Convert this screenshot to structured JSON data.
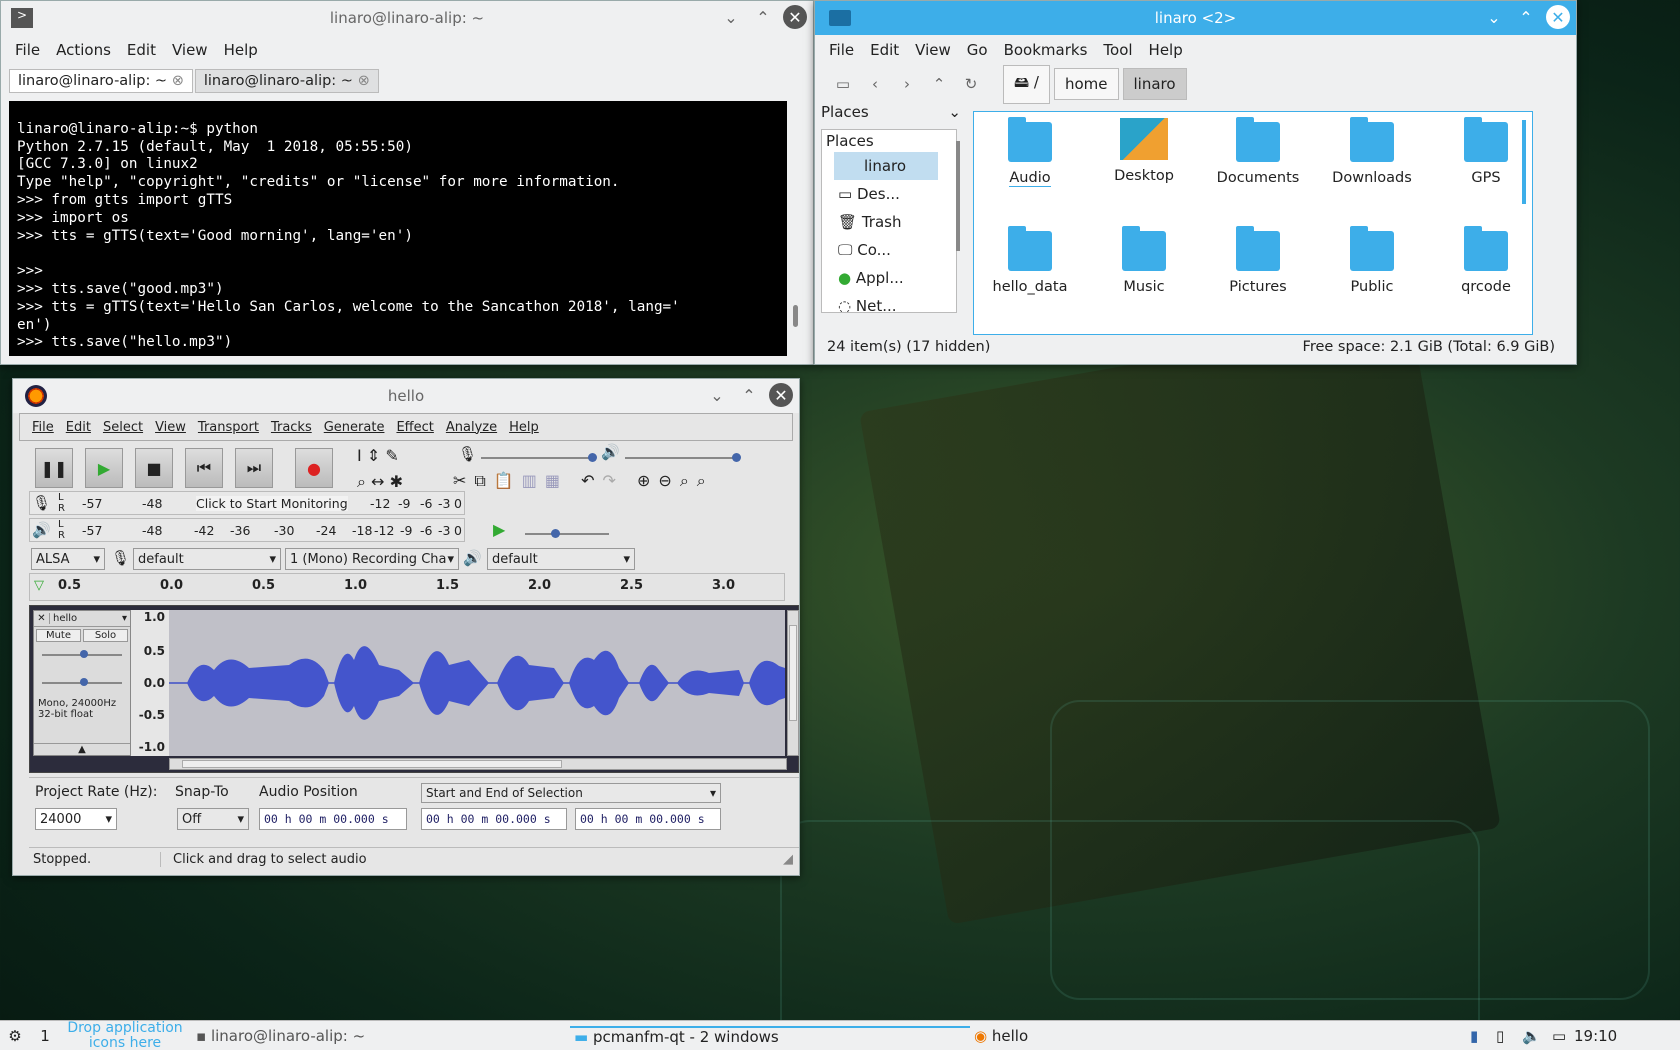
{
  "terminal": {
    "title": "linaro@linaro-alip: ~",
    "menu": [
      "File",
      "Actions",
      "Edit",
      "View",
      "Help"
    ],
    "tabs": [
      "linaro@linaro-alip: ~",
      "linaro@linaro-alip: ~"
    ],
    "lines": [
      "linaro@linaro-alip:~$ python",
      "Python 2.7.15 (default, May  1 2018, 05:55:50)",
      "[GCC 7.3.0] on linux2",
      "Type \"help\", \"copyright\", \"credits\" or \"license\" for more information.",
      ">>> from gtts import gTTS",
      ">>> import os",
      ">>> tts = gTTS(text='Good morning', lang='en')",
      "",
      ">>> ",
      ">>> tts.save(\"good.mp3\")",
      ">>> tts = gTTS(text='Hello San Carlos, welcome to the Sancathon 2018', lang='",
      "en')",
      ">>> tts.save(\"hello.mp3\")"
    ]
  },
  "filemanager": {
    "title": "linaro <2>",
    "menu": [
      "File",
      "Edit",
      "View",
      "Go",
      "Bookmarks",
      "Tool",
      "Help"
    ],
    "crumbs": [
      "/",
      "home",
      "linaro"
    ],
    "places_label": "Places",
    "places_header": "Places",
    "places": [
      "linaro",
      "Des...",
      "Trash",
      "Co...",
      "Appl...",
      "Net..."
    ],
    "folders": [
      "Audio",
      "Desktop",
      "Documents",
      "Downloads",
      "GPS",
      "hello_data",
      "Music",
      "Pictures",
      "Public",
      "qrcode"
    ],
    "status_left": "24 item(s) (17 hidden)",
    "status_right": "Free space: 2.1 GiB (Total: 6.9 GiB)"
  },
  "audacity": {
    "title": "hello",
    "menu": [
      "File",
      "Edit",
      "Select",
      "View",
      "Transport",
      "Tracks",
      "Generate",
      "Effect",
      "Analyze",
      "Help"
    ],
    "meter_rec": [
      "-57",
      "-48",
      "Click to Start Monitoring",
      "-12",
      "-9",
      "-6",
      "-3",
      "0"
    ],
    "meter_play": [
      "-57",
      "-48",
      "-42",
      "-36",
      "-30",
      "-24",
      "-18",
      "-12",
      "-9",
      "-6",
      "-3",
      "0"
    ],
    "host": "ALSA",
    "rec_device": "default",
    "channels": "1 (Mono) Recording Cha",
    "play_device": "default",
    "ruler": [
      "0.5",
      "0.0",
      "0.5",
      "1.0",
      "1.5",
      "2.0",
      "2.5",
      "3.0"
    ],
    "track": {
      "name": "hello",
      "mute": "Mute",
      "solo": "Solo",
      "info1": "Mono, 24000Hz",
      "info2": "32-bit float",
      "scale": [
        "1.0",
        "0.5",
        "0.0",
        "-0.5",
        "-1.0"
      ]
    },
    "labels": {
      "rate": "Project Rate (Hz):",
      "snap": "Snap-To",
      "audiopos": "Audio Position",
      "selection": "Start and End of Selection"
    },
    "rate": "24000",
    "snap_val": "Off",
    "time": "00 h 00 m 00.000 s",
    "status": "Stopped.",
    "hint": "Click and drag to select audio"
  },
  "taskbar": {
    "desktop": "1",
    "drop": "Drop application icons here",
    "items": [
      "linaro@linaro-alip: ~",
      "pcmanfm-qt - 2 windows",
      "hello"
    ],
    "clock": "19:10"
  }
}
